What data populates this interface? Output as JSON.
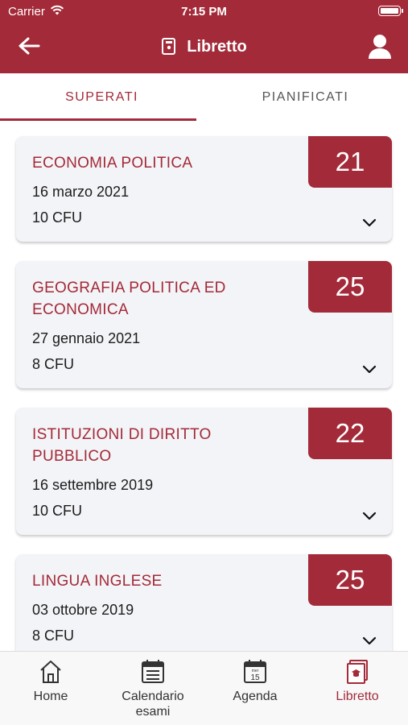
{
  "status_bar": {
    "carrier": "Carrier",
    "time": "7:15 PM"
  },
  "header": {
    "title": "Libretto",
    "title_icon": "book-icon",
    "back_icon": "arrow-left-icon",
    "profile_icon": "user-icon"
  },
  "tabs": [
    {
      "label": "SUPERATI",
      "active": true
    },
    {
      "label": "PIANIFICATI",
      "active": false
    }
  ],
  "exams": [
    {
      "name": "ECONOMIA POLITICA",
      "date": "16 marzo 2021",
      "cfu": "10 CFU",
      "grade": "21"
    },
    {
      "name": "GEOGRAFIA POLITICA ED ECONOMICA",
      "date": "27 gennaio 2021",
      "cfu": "8 CFU",
      "grade": "25"
    },
    {
      "name": "ISTITUZIONI DI DIRITTO PUBBLICO",
      "date": "16 settembre 2019",
      "cfu": "10 CFU",
      "grade": "22"
    },
    {
      "name": "LINGUA INGLESE",
      "date": "03 ottobre 2019",
      "cfu": "8 CFU",
      "grade": "25"
    }
  ],
  "tabbar": [
    {
      "label": "Home",
      "icon": "home-icon"
    },
    {
      "label": "Calendario esami",
      "icon": "calendar-icon"
    },
    {
      "label": "Agenda",
      "icon": "agenda-icon",
      "day": "mer",
      "date": "15"
    },
    {
      "label": "Libretto",
      "icon": "libretto-icon",
      "active": true
    }
  ],
  "colors": {
    "primary": "#a32a38",
    "card": "#f3f4f7"
  }
}
